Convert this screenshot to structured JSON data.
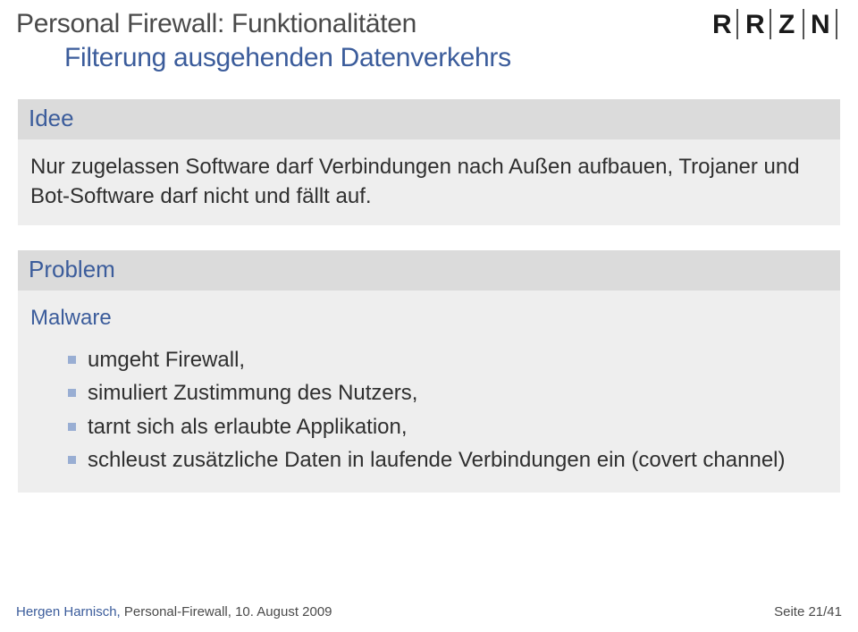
{
  "header": {
    "title": "Personal Firewall: Funktionalitäten",
    "subtitle": "Filterung ausgehenden Datenverkehrs",
    "logo_letters": [
      "R",
      "R",
      "Z",
      "N"
    ]
  },
  "section1": {
    "heading": "Idee",
    "body": "Nur zugelassen Software darf Verbindungen nach Außen aufbauen, Trojaner und Bot-Software darf nicht und fällt auf."
  },
  "section2": {
    "heading": "Problem",
    "lead": "Malware",
    "items": [
      "umgeht Firewall,",
      "simuliert Zustimmung des Nutzers,",
      "tarnt sich als erlaubte Applikation,",
      "schleust zusätzliche Daten in laufende Verbindungen ein (covert channel)"
    ]
  },
  "footer": {
    "author": "Hergen Harnisch, ",
    "rest": "Personal-Firewall, 10. August 2009",
    "page": "Seite 21/41"
  }
}
